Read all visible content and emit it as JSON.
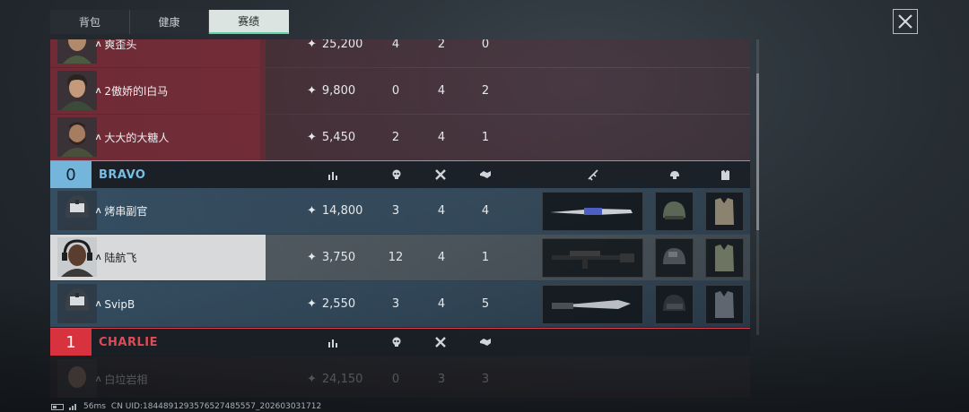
{
  "tabs": [
    {
      "label": "背包"
    },
    {
      "label": "健康"
    },
    {
      "label": "赛绩",
      "active": true
    }
  ],
  "teams": {
    "red_rows": [
      {
        "name": "爽歪头",
        "score": "25,200",
        "kills": "4",
        "deaths": "2",
        "assists": "0"
      },
      {
        "name": "2傲娇的l白马",
        "score": "9,800",
        "kills": "0",
        "deaths": "4",
        "assists": "2"
      },
      {
        "name": "大大的大糖人",
        "score": "5,450",
        "kills": "2",
        "deaths": "4",
        "assists": "1"
      }
    ],
    "bravo": {
      "number": "0",
      "name": "BRAVO",
      "players": [
        {
          "name": "烤串副官",
          "score": "14,800",
          "kills": "3",
          "deaths": "4",
          "assists": "4",
          "weapon": "knife-a"
        },
        {
          "name": "陆航飞",
          "score": "3,750",
          "kills": "12",
          "deaths": "4",
          "assists": "1",
          "weapon": "rifle",
          "self": true
        },
        {
          "name": "SvipB",
          "score": "2,550",
          "kills": "3",
          "deaths": "4",
          "assists": "5",
          "weapon": "knife-b"
        }
      ]
    },
    "charlie": {
      "number": "1",
      "name": "CHARLIE",
      "players": [
        {
          "name": "白垃岩相",
          "score": "24,150",
          "kills": "0",
          "deaths": "3",
          "assists": "3"
        }
      ]
    }
  },
  "columns": {
    "score_icon": "bar-chart-icon",
    "kills_icon": "skull-icon",
    "deaths_icon": "crossed-x-icon",
    "assists_icon": "handshake-icon",
    "weapon_icon": "rifle-icon",
    "helmet_icon": "helmet-icon",
    "vest_icon": "vest-icon"
  },
  "footer": {
    "ping": "56ms",
    "uid": "CN UID:1844891293576527485557_202603031712"
  },
  "colors": {
    "bravo": "#74b5dc",
    "charlie": "#d8323f",
    "tab_active_accent": "#5fd0a4"
  }
}
